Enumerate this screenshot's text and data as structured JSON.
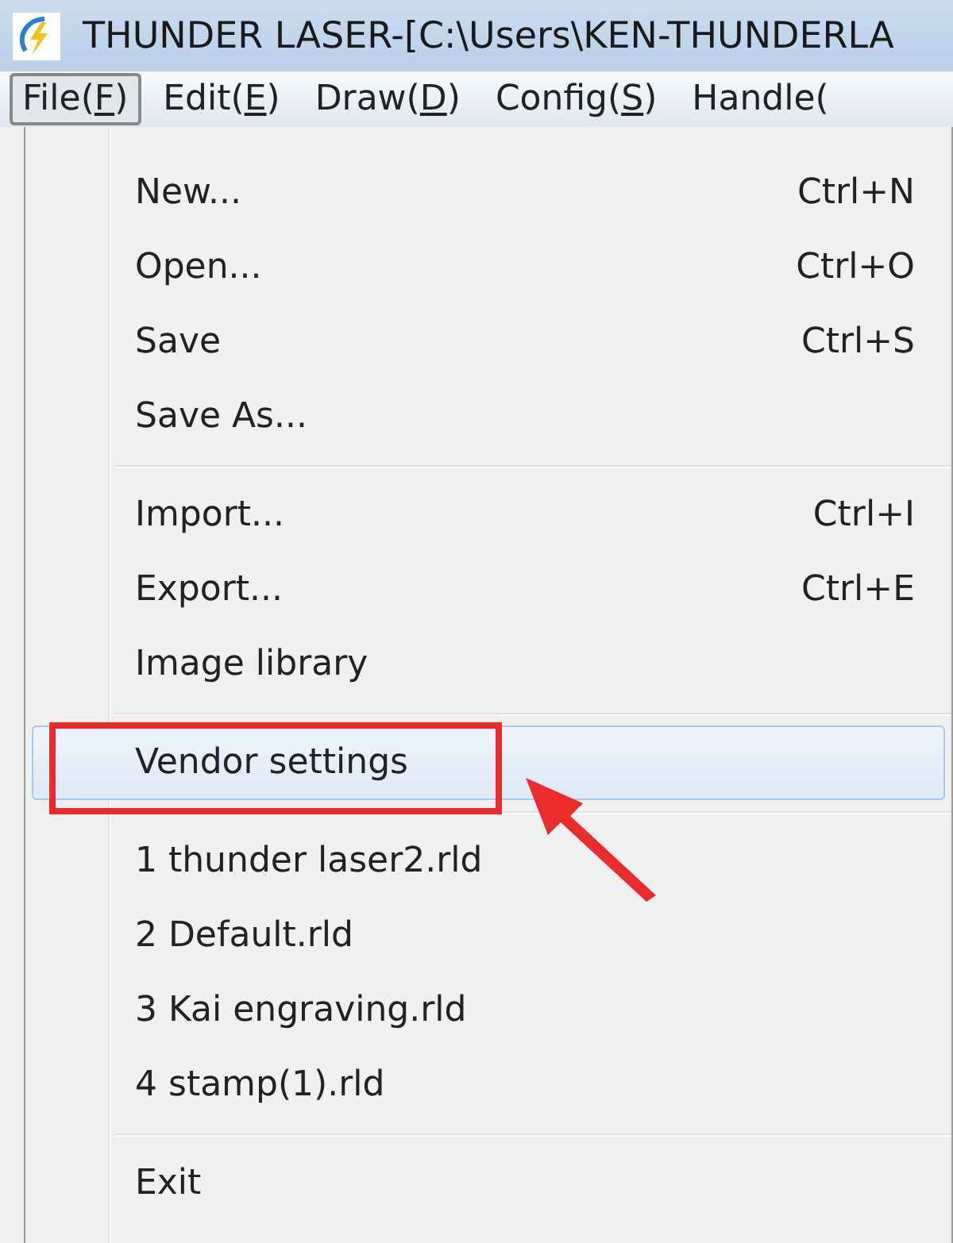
{
  "window": {
    "title": "THUNDER LASER-[C:\\Users\\KEN-THUNDERLA"
  },
  "menubar": [
    {
      "label": "File(F)",
      "selected": true
    },
    {
      "label": "Edit(E)",
      "selected": false
    },
    {
      "label": "Draw(D)",
      "selected": false
    },
    {
      "label": "Config(S)",
      "selected": false
    },
    {
      "label": "Handle(",
      "selected": false
    }
  ],
  "menu": [
    {
      "kind": "item",
      "label": "New...",
      "shortcut": "Ctrl+N",
      "selected": false
    },
    {
      "kind": "item",
      "label": "Open...",
      "shortcut": "Ctrl+O",
      "selected": false
    },
    {
      "kind": "item",
      "label": "Save",
      "shortcut": "Ctrl+S",
      "selected": false
    },
    {
      "kind": "item",
      "label": "Save As...",
      "selected": false
    },
    {
      "kind": "separator"
    },
    {
      "kind": "item",
      "label": "Import...",
      "shortcut": "Ctrl+I",
      "selected": false
    },
    {
      "kind": "item",
      "label": "Export...",
      "shortcut": "Ctrl+E",
      "selected": false
    },
    {
      "kind": "item",
      "label": "Image library",
      "selected": false
    },
    {
      "kind": "separator"
    },
    {
      "kind": "item",
      "label": "Vendor settings",
      "selected": true
    },
    {
      "kind": "separator"
    },
    {
      "kind": "item",
      "label": "1 thunder laser2.rld",
      "selected": false
    },
    {
      "kind": "item",
      "label": "2 Default.rld",
      "selected": false
    },
    {
      "kind": "item",
      "label": "3 Kai engraving.rld",
      "selected": false
    },
    {
      "kind": "item",
      "label": "4 stamp(1).rld",
      "selected": false
    },
    {
      "kind": "separator"
    },
    {
      "kind": "item",
      "label": "Exit",
      "selected": false
    }
  ]
}
